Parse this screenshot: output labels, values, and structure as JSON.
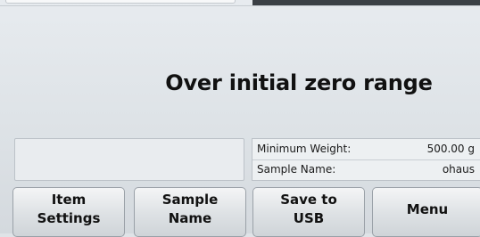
{
  "message": "Over initial zero range",
  "info": {
    "rows": [
      {
        "label": "Minimum Weight:",
        "value": "500.00 g"
      },
      {
        "label": "Sample Name:",
        "value": "ohaus"
      }
    ]
  },
  "buttons": [
    {
      "label": "Item\nSettings"
    },
    {
      "label": "Sample\nName"
    },
    {
      "label": "Save to\nUSB"
    },
    {
      "label": "Menu"
    }
  ],
  "colors": {
    "background": "#dfe3e7",
    "top_bar": "#3b4045",
    "text": "#111111"
  }
}
